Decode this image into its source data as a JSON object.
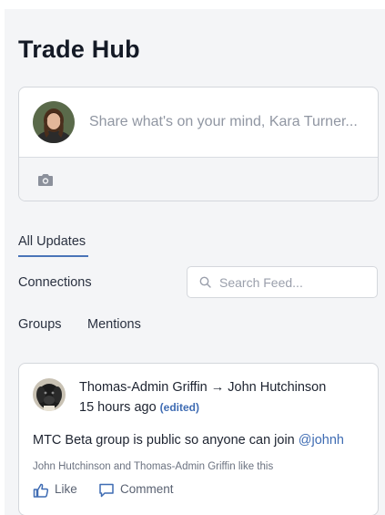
{
  "app": {
    "title": "Trade Hub"
  },
  "composer": {
    "placeholder": "Share what's on your mind, Kara Turner...",
    "attach_icon": "camera-icon"
  },
  "tabs": [
    {
      "label": "All Updates",
      "active": true
    },
    {
      "label": "Connections",
      "active": false
    },
    {
      "label": "Groups",
      "active": false
    },
    {
      "label": "Mentions",
      "active": false
    }
  ],
  "search": {
    "placeholder": "Search Feed..."
  },
  "post": {
    "author": "Thomas-Admin Griffin → John Hutchinson",
    "time": "15 hours ago",
    "edited": "(edited)",
    "body": "MTC Beta group is public so anyone can join ",
    "mention": "@johnh",
    "likes_summary": "John Hutchinson and Thomas-Admin Griffin like this",
    "like_label": "Like",
    "comment_label": "Comment"
  },
  "colors": {
    "accent": "#4a74b8",
    "link": "#3f6cb3",
    "background": "#f4f5f7"
  }
}
